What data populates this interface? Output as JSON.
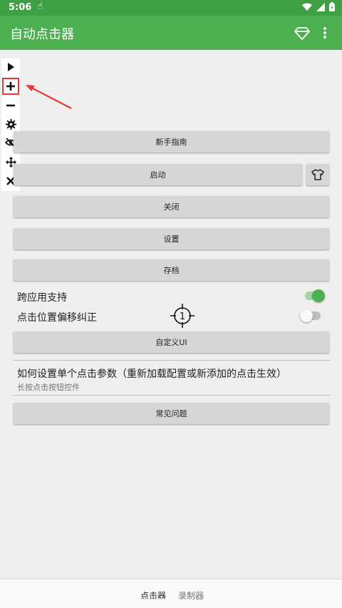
{
  "status_bar": {
    "time": "5:06"
  },
  "app_bar": {
    "title": "自动点击器"
  },
  "floating_toolbar": {
    "items": [
      "play-icon",
      "plus-icon",
      "minus-icon",
      "gear-icon",
      "eye-off-icon",
      "move-icon",
      "close-icon"
    ]
  },
  "buttons": {
    "guide": "新手指南",
    "start": "启动",
    "stop": "关闭",
    "settings": "设置",
    "save": "存档",
    "custom_ui": "自定义UI",
    "faq": "常见问题"
  },
  "toggles": {
    "cross_app_label": "跨应用支持",
    "cross_app_on": true,
    "offset_label": "点击位置偏移纠正",
    "offset_on": false
  },
  "crosshair_number": "1",
  "info": {
    "title": "如何设置单个点击参数（重新加载配置或新添加的点击生效）",
    "subtitle": "长按点击按钮控件"
  },
  "bottom_nav": {
    "tabs": [
      "点击器",
      "录制器"
    ],
    "active": "点击器"
  },
  "colors": {
    "primary": "#4caf50",
    "status_bar": "#3e9f44",
    "annotation": "#e53935"
  }
}
